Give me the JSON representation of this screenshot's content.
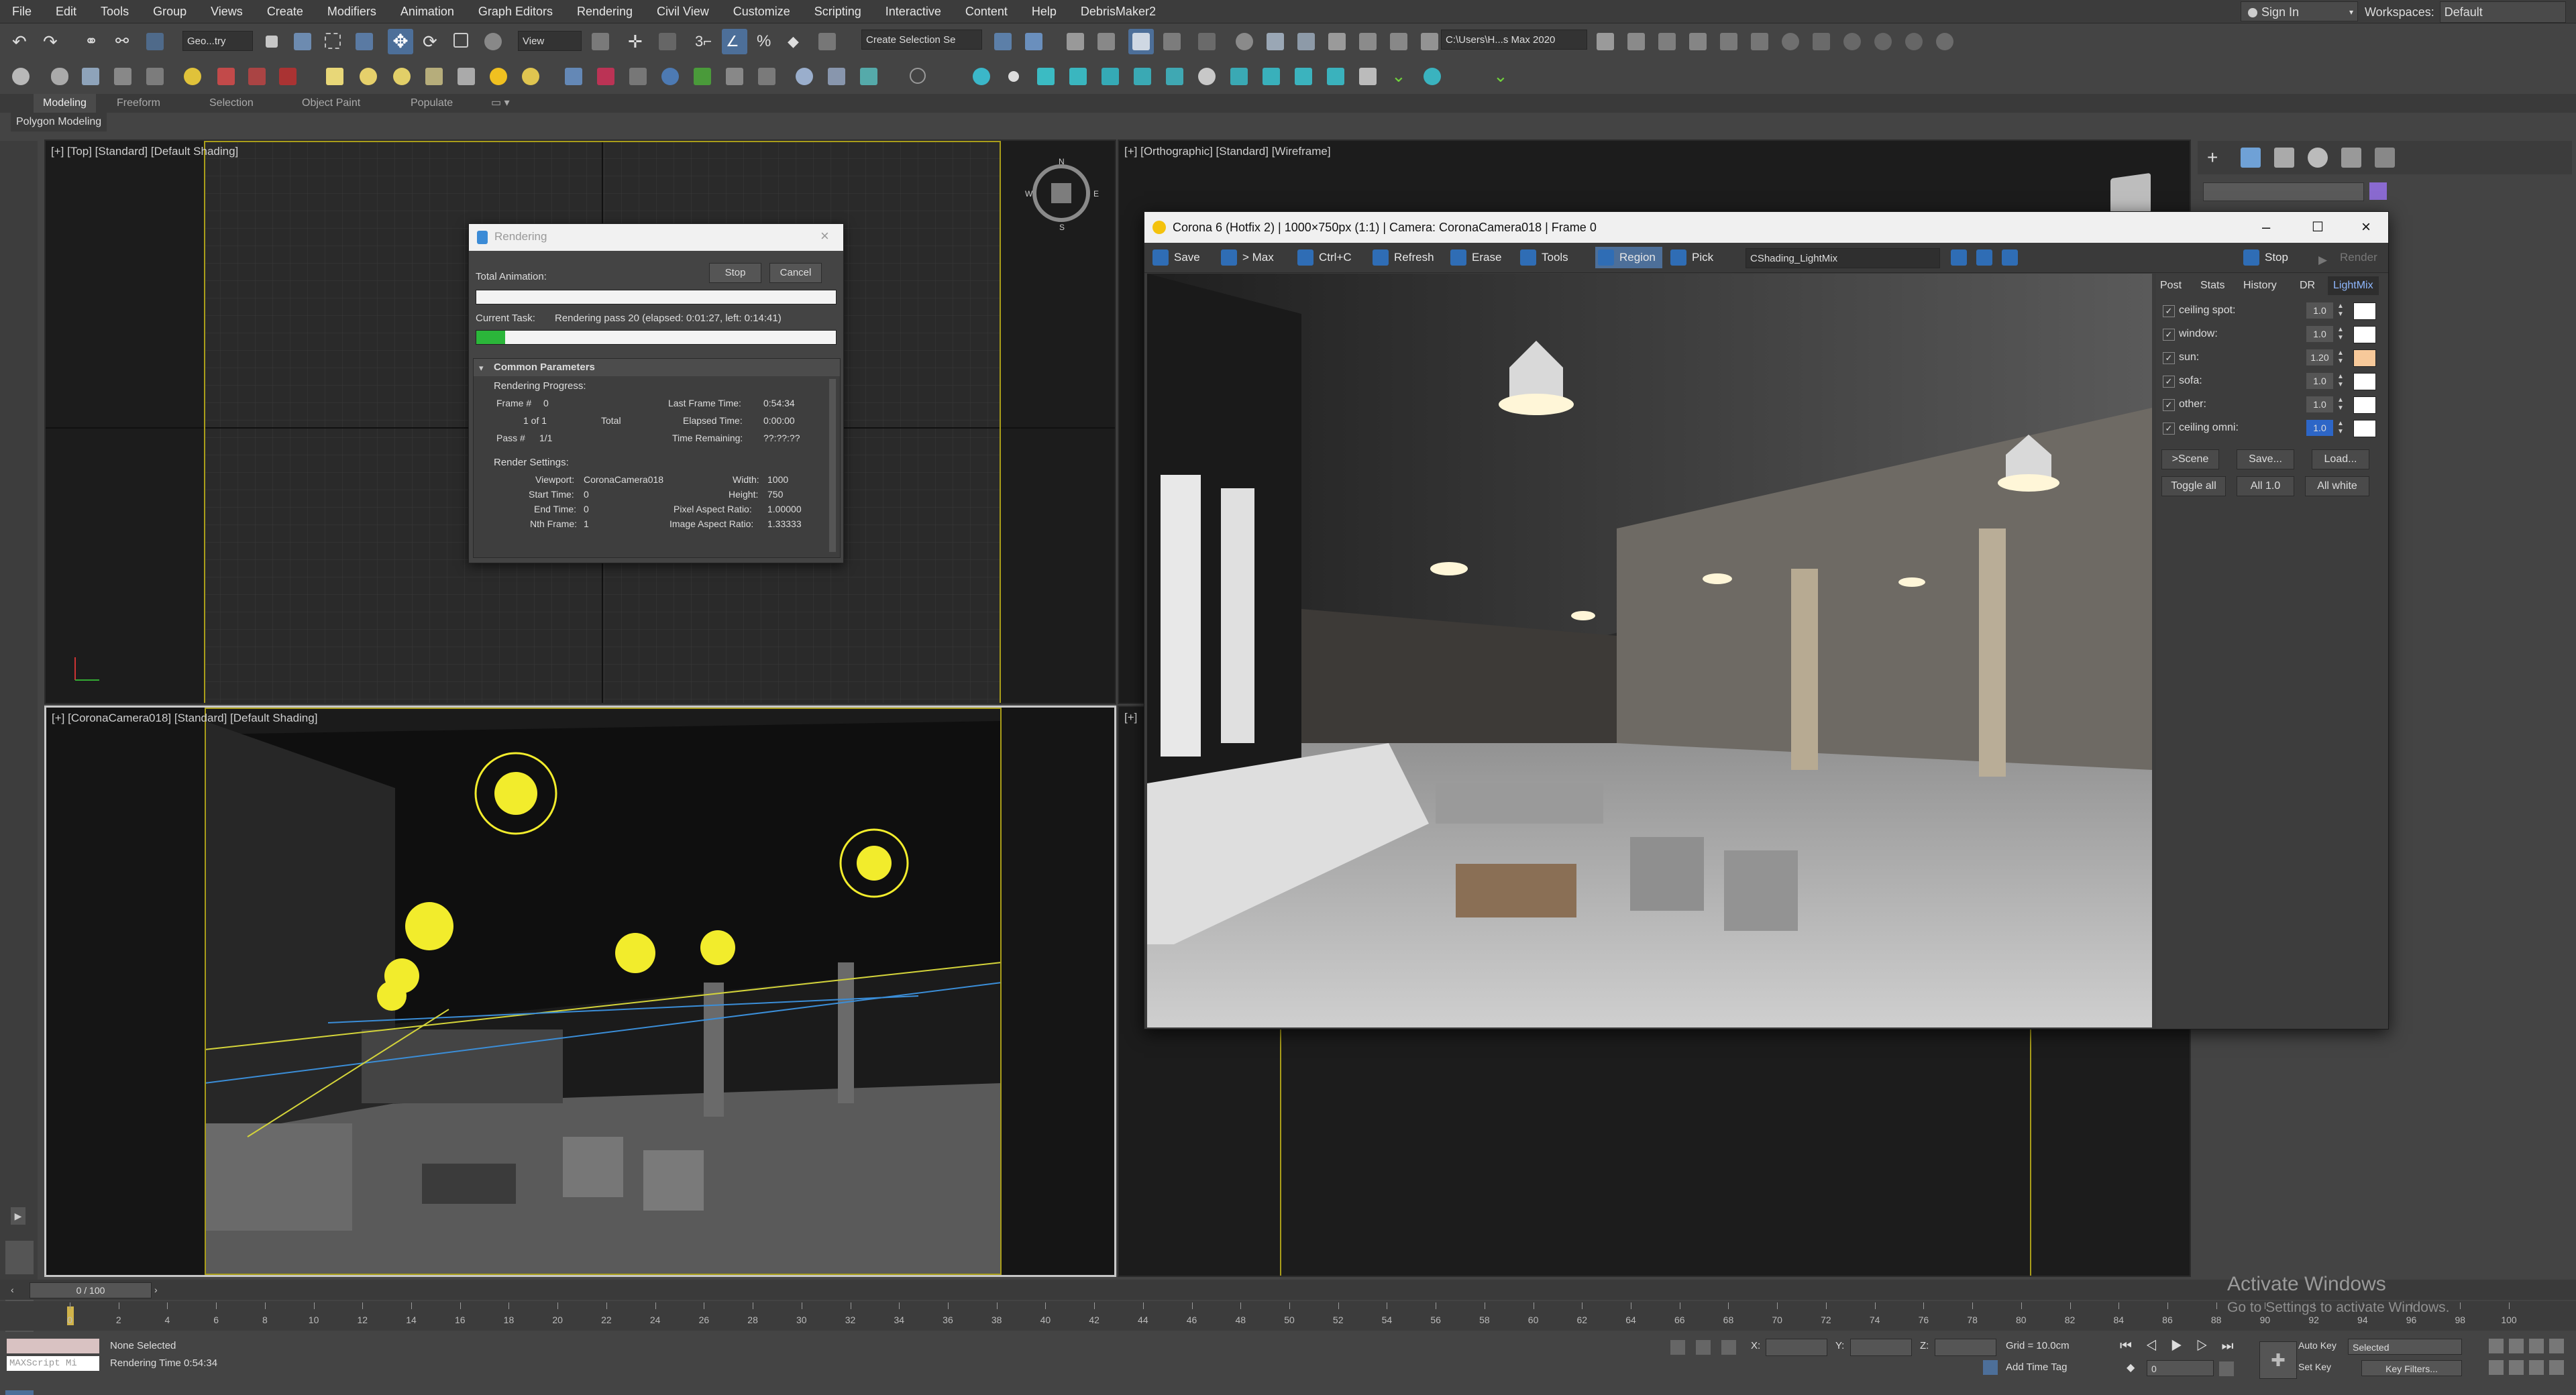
{
  "menu": [
    "File",
    "Edit",
    "Tools",
    "Group",
    "Views",
    "Create",
    "Modifiers",
    "Animation",
    "Graph Editors",
    "Rendering",
    "Civil View",
    "Customize",
    "Scripting",
    "Interactive",
    "Content",
    "Help",
    "DebrisMaker2"
  ],
  "signin": "Sign In",
  "workspaces": {
    "label": "Workspaces:",
    "value": "Default"
  },
  "toolbar": {
    "filter_combo": "Geo...try",
    "view_combo": "View",
    "selection_set": "Create Selection Se",
    "path_combo": "C:\\Users\\H...s Max 2020"
  },
  "ribbon": {
    "tabs": [
      "Modeling",
      "Freeform",
      "Selection",
      "Object Paint",
      "Populate"
    ],
    "subtab": "Polygon Modeling"
  },
  "viewports": {
    "top": "[+] [Top] [Standard] [Default Shading]",
    "ortho": "[+] [Orthographic] [Standard] [Wireframe]",
    "camera": "[+] [CoronaCamera018] [Standard] [Default Shading]",
    "bottom_right": "[+]",
    "viewcube": {
      "n": "N",
      "s": "S",
      "w": "W",
      "e": "E"
    }
  },
  "render_dialog": {
    "title": "Rendering",
    "total_animation": "Total Animation:",
    "stop": "Stop",
    "cancel": "Cancel",
    "current_task_label": "Current Task:",
    "current_task": "Rendering pass 20 (elapsed: 0:01:27, left: 0:14:41)",
    "progress": 0.08,
    "section": "Common Parameters",
    "progress_title": "Rendering Progress:",
    "frame_label": "Frame #",
    "frame_value": "0",
    "frames_of": "1 of 1",
    "total": "Total",
    "pass_label": "Pass #",
    "pass_value": "1/1",
    "last_frame_time_label": "Last Frame Time:",
    "last_frame_time": "0:54:34",
    "elapsed_time_label": "Elapsed Time:",
    "elapsed_time": "0:00:00",
    "time_remaining_label": "Time Remaining:",
    "time_remaining": "??:??:??",
    "render_settings": "Render Settings:",
    "viewport_label": "Viewport:",
    "viewport": "CoronaCamera018",
    "width_label": "Width:",
    "width": "1000",
    "start_time_label": "Start Time:",
    "start_time": "0",
    "height_label": "Height:",
    "height": "750",
    "end_time_label": "End Time:",
    "end_time": "0",
    "pixel_aspect_label": "Pixel Aspect Ratio:",
    "pixel_aspect": "1.00000",
    "nth_frame_label": "Nth Frame:",
    "nth_frame": "1",
    "image_aspect_label": "Image Aspect Ratio:",
    "image_aspect": "1.33333"
  },
  "vfb": {
    "title": "Corona 6 (Hotfix 2) | 1000×750px (1:1) | Camera: CoronaCamera018 | Frame 0",
    "buttons": [
      "Save",
      "> Max",
      "Ctrl+C",
      "Refresh",
      "Erase",
      "Tools",
      "Region",
      "Pick"
    ],
    "lightmix_combo": "CShading_LightMix",
    "stop": "Stop",
    "render": "Render",
    "tabs": [
      "Post",
      "Stats",
      "History",
      "DR",
      "LightMix"
    ],
    "lights": [
      {
        "name": "ceiling spot:",
        "value": "1.0",
        "color": "#ffffff"
      },
      {
        "name": "window:",
        "value": "1.0",
        "color": "#ffffff"
      },
      {
        "name": "sun:",
        "value": "1.20",
        "color": "#f7c99a"
      },
      {
        "name": "sofa:",
        "value": "1.0",
        "color": "#ffffff"
      },
      {
        "name": "other:",
        "value": "1.0",
        "color": "#ffffff"
      },
      {
        "name": "ceiling omni:",
        "value": "1.0",
        "color": "#ffffff"
      }
    ],
    "row_buttons_1": [
      ">Scene",
      "Save...",
      "Load..."
    ],
    "row_buttons_2": [
      "Toggle all",
      "All 1.0",
      "All white"
    ]
  },
  "timeline": {
    "frame_counter": "0 / 100",
    "ticks": [
      "0",
      "2",
      "4",
      "6",
      "8",
      "10",
      "12",
      "14",
      "16",
      "18",
      "20",
      "22",
      "24",
      "26",
      "28",
      "30",
      "32",
      "34",
      "36",
      "38",
      "40",
      "42",
      "44",
      "46",
      "48",
      "50",
      "52",
      "54",
      "56",
      "58",
      "60",
      "62",
      "64",
      "66",
      "68",
      "70",
      "72",
      "74",
      "76",
      "78",
      "80",
      "82",
      "84",
      "86",
      "88",
      "90",
      "92",
      "94",
      "96",
      "98",
      "100"
    ]
  },
  "status": {
    "maxscript": "MAXScript Mi",
    "selected": "None Selected",
    "render_time": "Rendering Time  0:54:34",
    "x_label": "X:",
    "y_label": "Y:",
    "z_label": "Z:",
    "grid": "Grid = 10.0cm",
    "add_time_tag": "Add Time Tag",
    "auto_key": "Auto Key",
    "set_key": "Set Key",
    "selected_combo": "Selected",
    "key_filters": "Key Filters...",
    "frame_field": "0"
  },
  "watermark": {
    "line1": "Activate Windows",
    "line2": "Go to Settings to activate Windows."
  }
}
